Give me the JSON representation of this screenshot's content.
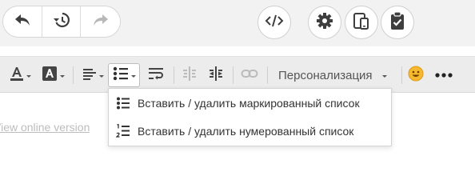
{
  "topbar": {
    "undo_icon": "undo-icon",
    "history_icon": "history-icon",
    "redo_icon": "redo-icon",
    "code_icon": "code-icon",
    "settings_icon": "gear-icon",
    "devices_icon": "devices-icon",
    "clipboard_icon": "clipboard-check-icon"
  },
  "toolbar": {
    "personalization_label": "Персонализация",
    "emoji_icon": "smiley-icon",
    "more_icon": "more-dots-icon"
  },
  "content": {
    "link_text": "View online version"
  },
  "dropdown": {
    "items": [
      {
        "label": "Вставить / удалить маркированный список",
        "icon": "bulleted-list-icon"
      },
      {
        "label": "Вставить / удалить нумерованный список",
        "icon": "numbered-list-icon"
      }
    ]
  },
  "colors": {
    "icon_dark": "#444444",
    "icon_disabled": "#bbbbbb",
    "toolbar_bg": "#ececec",
    "link_gray": "#bdbdbd"
  }
}
